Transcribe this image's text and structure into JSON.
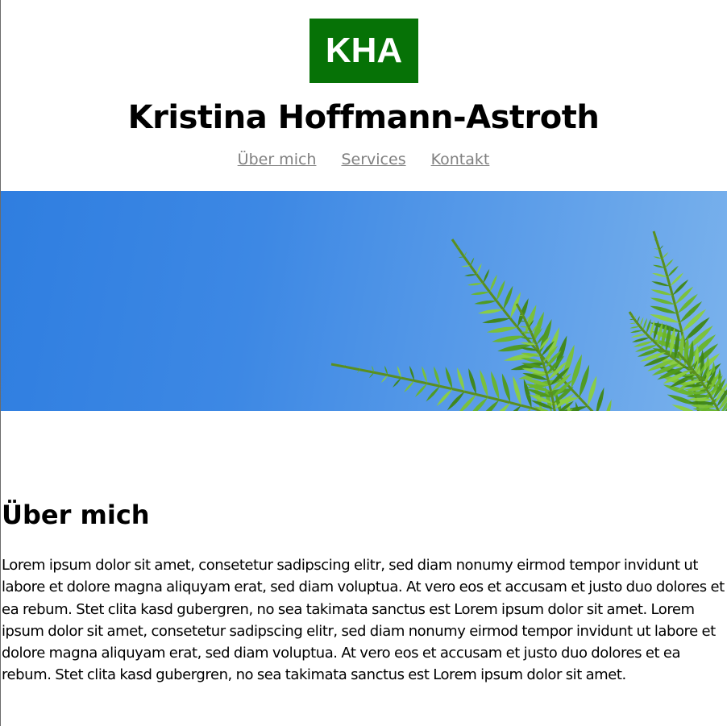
{
  "header": {
    "logo_text": "KHA",
    "site_title": "Kristina Hoffmann-Astroth",
    "nav": [
      {
        "label": "Über mich"
      },
      {
        "label": "Services"
      },
      {
        "label": "Kontakt"
      }
    ]
  },
  "hero": {
    "image": "fern-leaves-blue-sky"
  },
  "about": {
    "heading": "Über mich",
    "body": "Lorem ipsum dolor sit amet, consetetur sadipscing elitr, sed diam nonumy eirmod tempor invidunt ut labore et dolore magna aliquyam erat, sed diam voluptua. At vero eos et accusam et justo duo dolores et ea rebum. Stet clita kasd gubergren, no sea takimata sanctus est Lorem ipsum dolor sit amet. Lorem ipsum dolor sit amet, consetetur sadipscing elitr, sed diam nonumy eirmod tempor invidunt ut labore et dolore magna aliquyam erat, sed diam voluptua. At vero eos et accusam et justo duo dolores et ea rebum. Stet clita kasd gubergren, no sea takimata sanctus est Lorem ipsum dolor sit amet."
  },
  "colors": {
    "logo_background": "#067206",
    "nav_link": "#808080",
    "sky_blue": "#3d88e4",
    "fern_green": "#5da51f"
  }
}
